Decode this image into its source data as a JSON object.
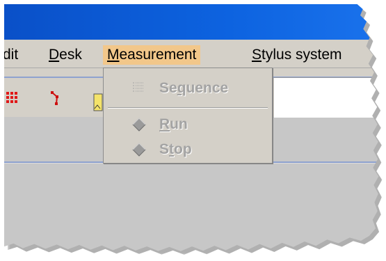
{
  "menubar": {
    "items": [
      {
        "prefix": "",
        "underline": "",
        "rest": "dit"
      },
      {
        "prefix": "",
        "underline": "D",
        "rest": "esk"
      },
      {
        "prefix": "",
        "underline": "M",
        "rest": "easurement"
      },
      {
        "prefix": "",
        "underline": "S",
        "rest": "tylus system"
      }
    ],
    "active_item": "Measurement"
  },
  "dropdown": {
    "items": [
      {
        "pre": "Se",
        "underline": "q",
        "post": "uence",
        "icon": "sequence-list-icon",
        "enabled": false
      },
      {
        "pre": "",
        "underline": "R",
        "post": "un",
        "icon": "diamond-icon",
        "enabled": false
      },
      {
        "pre": "S",
        "underline": "t",
        "post": "op",
        "icon": "diamond-icon",
        "enabled": false
      }
    ]
  },
  "toolbar": {
    "icons": [
      "grid-dots-icon",
      "polyline-icon",
      "note-icon"
    ]
  },
  "colors": {
    "title_bar": "#0d63e0",
    "menu_active": "#f2c78a",
    "chrome": "#d4d0c8",
    "disabled_text": "#a3a3a3"
  }
}
